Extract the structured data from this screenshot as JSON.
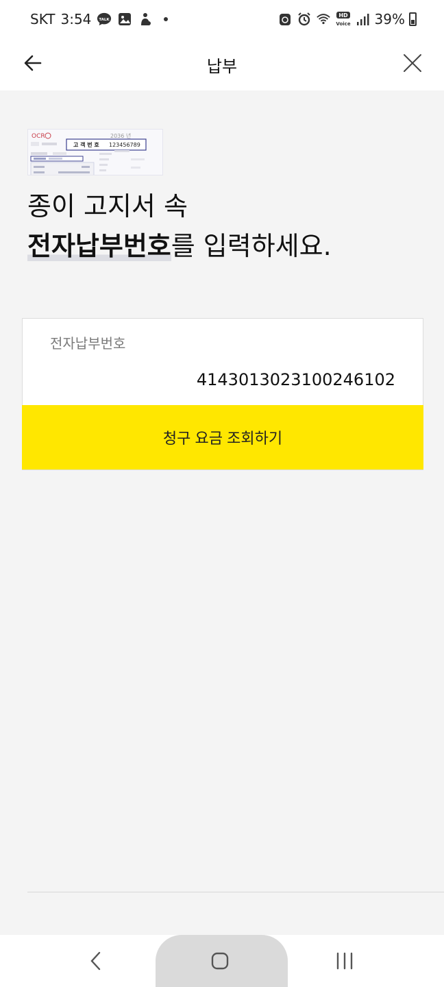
{
  "status_bar": {
    "carrier": "SKT",
    "time": "3:54",
    "battery": "39%",
    "talk_badge": "TALK",
    "hd_badge": "HD",
    "voice_badge": "Voice"
  },
  "app_bar": {
    "title": "납부"
  },
  "bill_image": {
    "ocr_label": "OCR",
    "customer_no_label": "고 객 번 호",
    "customer_no": "123456789",
    "year": "2036 년"
  },
  "headline": {
    "line1": "종이 고지서 속",
    "line2_strong": "전자납부번호",
    "line2_rest": "를 입력하세요."
  },
  "form": {
    "field_label": "전자납부번호",
    "field_value": "4143013023100246102",
    "submit_label": "청구 요금 조회하기"
  },
  "colors": {
    "accent": "#ffe700",
    "background": "#f4f4f4"
  },
  "icons": {
    "back": "arrow-left-icon",
    "close": "close-icon",
    "nav_back": "chevron-left-icon",
    "nav_home": "home-icon",
    "nav_recents": "recents-icon"
  }
}
